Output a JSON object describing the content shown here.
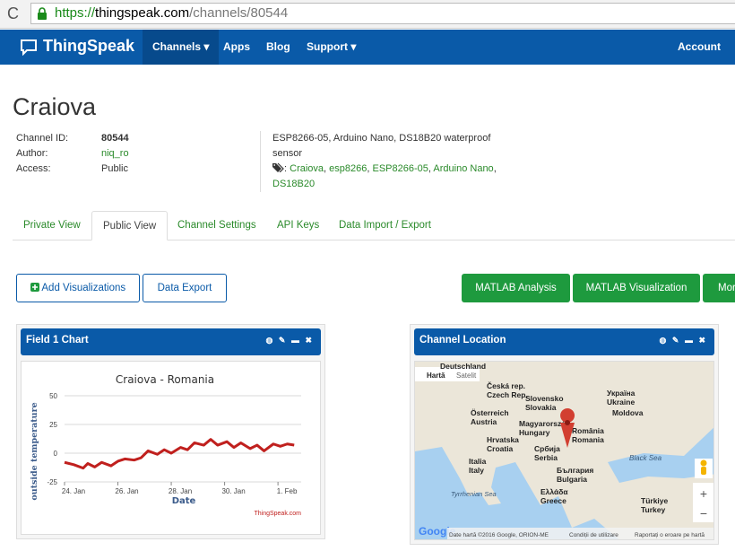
{
  "browser": {
    "url_scheme": "https://",
    "url_host": "thingspeak.com",
    "url_path": "/channels/80544"
  },
  "nav": {
    "brand": "ThingSpeak",
    "channels": "Channels ▾",
    "apps": "Apps",
    "blog": "Blog",
    "support": "Support ▾",
    "account": "Account ▾"
  },
  "channel": {
    "name": "Craiova",
    "id_label": "Channel ID:",
    "id_value": "80544",
    "author_label": "Author:",
    "author_value": "niq_ro",
    "access_label": "Access:",
    "access_value": "Public",
    "description": "ESP8266-05, Arduino Nano, DS18B20 waterproof sensor",
    "tags": [
      "Craiova",
      "esp8266",
      "ESP8266-05",
      "Arduino Nano",
      "DS18B20"
    ]
  },
  "tabs": [
    "Private View",
    "Public View",
    "Channel Settings",
    "API Keys",
    "Data Import / Export"
  ],
  "buttons": {
    "add_viz": "Add Visualizations",
    "data_export": "Data Export",
    "matlab_analysis": "MATLAB Analysis",
    "matlab_viz": "MATLAB Visualization",
    "more": "More"
  },
  "field_panel": {
    "title": "Field 1 Chart",
    "credit": "ThingSpeak.com"
  },
  "location_panel": {
    "title": "Channel Location"
  },
  "map": {
    "map_tab": "Hartă",
    "sat_tab": "Satelit",
    "labels": [
      "Deutschland",
      "Česká rep.",
      "Czech Rep.",
      "Slovensko",
      "Slovakia",
      "Österreich",
      "Austria",
      "Magyarország",
      "Hungary",
      "Україна",
      "Ukraine",
      "Moldova",
      "România",
      "Romania",
      "Hrvatska",
      "Croatia",
      "Србија",
      "Serbia",
      "Italia",
      "Italy",
      "България",
      "Bulgaria",
      "Black Sea",
      "Tyrrhenian Sea",
      "Ελλάδα",
      "Greece",
      "Türkiye",
      "Turkey"
    ],
    "footer": "Date hartă ©2016 Google, ORION-ME",
    "terms": "Condiții de utilizare",
    "report": "Raportați o eroare pe hartă",
    "google": "Google",
    "zoom_in": "+",
    "zoom_out": "−",
    "accent": "#a8d0f0"
  },
  "chart_data": {
    "type": "line",
    "title": "Craiova - Romania",
    "xlabel": "Date",
    "ylabel": "outside temperature",
    "ylim": [
      -25,
      50
    ],
    "yticks": [
      "50",
      "25",
      "0",
      "-25"
    ],
    "xticks": [
      "24. Jan",
      "26. Jan",
      "28. Jan",
      "30. Jan",
      "1. Feb"
    ],
    "x_days": [
      0,
      0.4,
      0.8,
      1.0,
      1.3,
      1.6,
      2.0,
      2.3,
      2.6,
      3.0,
      3.3,
      3.6,
      4.0,
      4.3,
      4.6,
      5.0,
      5.3,
      5.6,
      6.0,
      6.3,
      6.6,
      7.0,
      7.3,
      7.6,
      8.0,
      8.3,
      8.6,
      9.0,
      9.3,
      9.6,
      9.9
    ],
    "values": [
      -8,
      -10,
      -13,
      -9,
      -12,
      -8,
      -11,
      -7,
      -5,
      -6,
      -4,
      2,
      -1,
      3,
      0,
      5,
      3,
      9,
      7,
      12,
      7,
      10,
      5,
      9,
      4,
      7,
      2,
      8,
      6,
      8,
      7
    ],
    "series_color": "#c0201e"
  }
}
